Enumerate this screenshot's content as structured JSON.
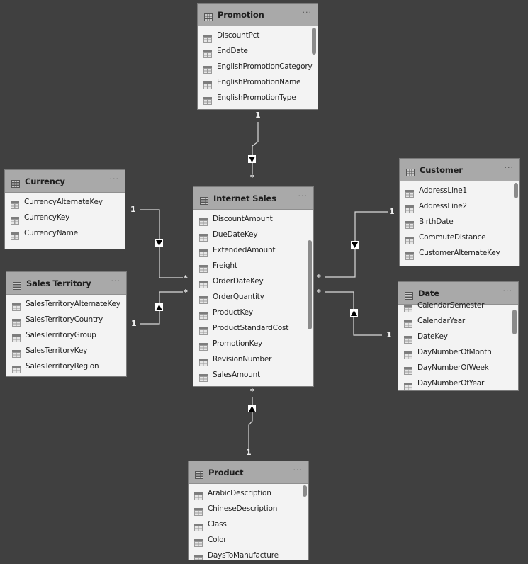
{
  "tables": {
    "promotion": {
      "name": "Promotion",
      "more": "···",
      "fields": [
        "DiscountPct",
        "EndDate",
        "EnglishPromotionCategory",
        "EnglishPromotionName",
        "EnglishPromotionType"
      ]
    },
    "internet_sales": {
      "name": "Internet Sales",
      "more": "···",
      "fields": [
        "DiscountAmount",
        "DueDateKey",
        "ExtendedAmount",
        "Freight",
        "OrderDateKey",
        "OrderQuantity",
        "ProductKey",
        "ProductStandardCost",
        "PromotionKey",
        "RevisionNumber",
        "SalesAmount"
      ]
    },
    "currency": {
      "name": "Currency",
      "more": "···",
      "fields": [
        "CurrencyAlternateKey",
        "CurrencyKey",
        "CurrencyName"
      ]
    },
    "sales_territory": {
      "name": "Sales Territory",
      "more": "···",
      "fields": [
        "SalesTerritoryAlternateKey",
        "SalesTerritoryCountry",
        "SalesTerritoryGroup",
        "SalesTerritoryKey",
        "SalesTerritoryRegion"
      ]
    },
    "customer": {
      "name": "Customer",
      "more": "···",
      "fields": [
        "AddressLine1",
        "AddressLine2",
        "BirthDate",
        "CommuteDistance",
        "CustomerAlternateKey"
      ]
    },
    "date": {
      "name": "Date",
      "more": "···",
      "fields": [
        "CalendarSemester",
        "CalendarYear",
        "DateKey",
        "DayNumberOfMonth",
        "DayNumberOfWeek",
        "DayNumberOfYear"
      ]
    },
    "product": {
      "name": "Product",
      "more": "···",
      "fields": [
        "ArabicDescription",
        "ChineseDescription",
        "Class",
        "Color",
        "DaysToManufacture"
      ]
    }
  },
  "relationships": [
    {
      "from": "Promotion",
      "to": "Internet Sales",
      "one": "1",
      "many": "*",
      "direction": "down"
    },
    {
      "from": "Currency",
      "to": "Internet Sales",
      "one": "1",
      "many": "*",
      "direction": "down"
    },
    {
      "from": "Sales Territory",
      "to": "Internet Sales",
      "one": "1",
      "many": "*",
      "direction": "up"
    },
    {
      "from": "Customer",
      "to": "Internet Sales",
      "one": "1",
      "many": "*",
      "direction": "down"
    },
    {
      "from": "Date",
      "to": "Internet Sales",
      "one": "1",
      "many": "*",
      "direction": "up"
    },
    {
      "from": "Product",
      "to": "Internet Sales",
      "one": "1",
      "many": "*",
      "direction": "up"
    }
  ],
  "colors": {
    "canvas": "#404040",
    "header": "#a9a9a9",
    "body": "#f3f3f3",
    "line": "#d8d8d8"
  }
}
